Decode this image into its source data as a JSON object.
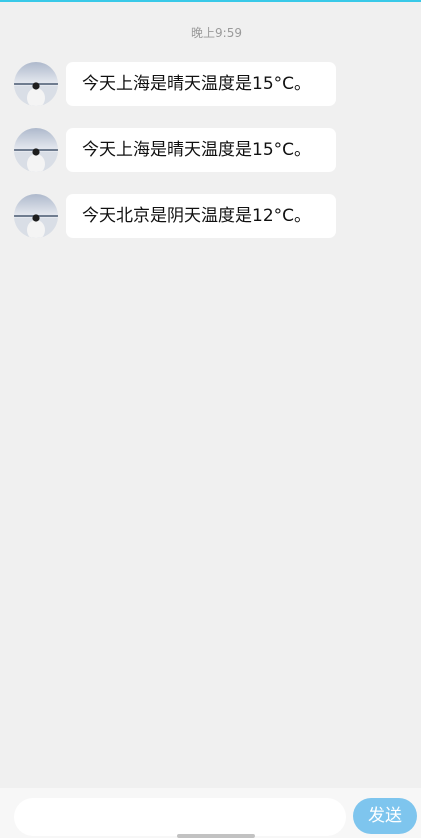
{
  "time": "晚上9:59",
  "messages": [
    {
      "text": "今天上海是晴天温度是15°C。"
    },
    {
      "text": "今天上海是晴天温度是15°C。"
    },
    {
      "text": "今天北京是阴天温度是12°C。"
    }
  ],
  "input": {
    "placeholder": "",
    "value": ""
  },
  "send_label": "发送",
  "colors": {
    "background": "#f0f0f0",
    "bubble": "#ffffff",
    "send_button": "#7ec5ee",
    "top_accent": "#39c9e8"
  }
}
